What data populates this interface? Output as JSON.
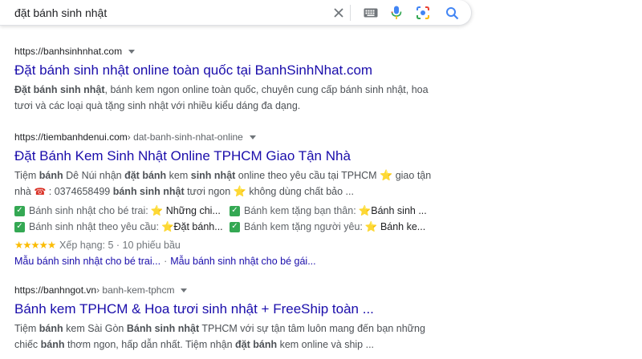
{
  "search": {
    "query": "đặt bánh sinh nhật",
    "icons": [
      "close-icon",
      "keyboard-icon",
      "microphone-icon",
      "camera-lens-icon",
      "search-icon"
    ]
  },
  "results": [
    {
      "url": "https://banhsinhnhat.com",
      "title": "Đặt bánh sinh nhật online toàn quốc tại BanhSinhNhat.com",
      "snippet_l1_b1": "Đặt bánh sinh nhật",
      "snippet_l1_t1": ", bánh kem ngon online toàn quốc, chuyên cung cấp bánh sinh nhật, hoa",
      "snippet_l2": "tươi và các loại quà tặng sinh nhật với nhiều kiểu dáng đa dạng."
    },
    {
      "url": "https://tiembanhdenui.com",
      "path": " › dat-banh-sinh-nhat-online",
      "title": "Đặt Bánh Kem Sinh Nhật Online TPHCM Giao Tận Nhà",
      "s1_t1": "Tiệm ",
      "s1_b1": "bánh",
      "s1_t2": " Dê Núi nhận ",
      "s1_b2": "đặt bánh",
      "s1_t3": " kem ",
      "s1_b3": "sinh nhật",
      "s1_t4": " online theo yêu cầu tại TPHCM ",
      "s1_t5": " giao tận",
      "s2_t1": "nhà ",
      "s2_t2": " : 0374658499 ",
      "s2_b1": "bánh sinh nhật",
      "s2_t3": " tươi ngon ",
      "s2_t4": " không dùng chất bảo ...",
      "features": [
        {
          "label": "Bánh sinh nhật cho bé trai:",
          "value": "⭐ Những chi..."
        },
        {
          "label": "Bánh kem tặng bạn thân:",
          "value": "⭐Bánh sinh ..."
        },
        {
          "label": "Bánh sinh nhật theo yêu cầu:",
          "value": "⭐Đặt bánh..."
        },
        {
          "label": "Bánh kem tặng người yêu:",
          "value": "⭐ Bánh ke..."
        }
      ],
      "rating_stars": "★★★★★",
      "rating_text": "Xếp hạng: 5 · 10 phiếu bầu",
      "sitelink_1": "Mẫu bánh sinh nhật cho bé trai...",
      "sitelink_sep": "·",
      "sitelink_2": "Mẫu bánh sinh nhật cho bé gái..."
    },
    {
      "url": "https://banhngot.vn",
      "path": " › banh-kem-tphcm",
      "title": "Bánh kem TPHCM & Hoa tươi sinh nhật + FreeShip toàn ...",
      "s1_t1": "Tiệm ",
      "s1_b1": "bánh",
      "s1_t2": " kem Sài Gòn ",
      "s1_b2": "Bánh sinh nhật",
      "s1_t3": " TPHCM với sự tận tâm luôn mang đến bạn những",
      "s2_t1": "chiếc ",
      "s2_b1": "bánh",
      "s2_t2": " thơm ngon, hấp dẫn nhất. Tiệm nhận ",
      "s2_b2": "đặt bánh",
      "s2_t3": " kem online và ship ..."
    }
  ],
  "symbols": {
    "star": "⭐",
    "phone": "☎",
    "check": "✓"
  }
}
